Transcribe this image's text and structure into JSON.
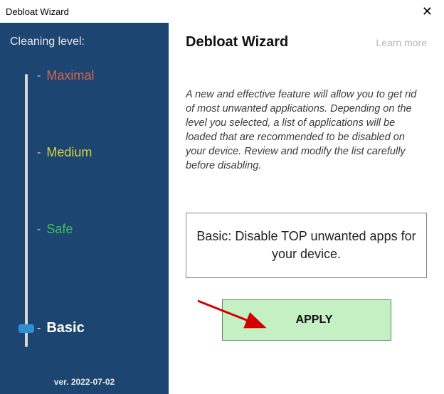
{
  "window": {
    "title": "Debloat Wizard"
  },
  "sidebar": {
    "title": "Cleaning level:",
    "levels": {
      "maximal": "Maximal",
      "medium": "Medium",
      "safe": "Safe",
      "basic": "Basic"
    },
    "version": "ver. 2022-07-02"
  },
  "main": {
    "title": "Debloat Wizard",
    "learn_more": "Learn more",
    "description": "A new and effective feature will allow you to get rid of most unwanted applications. Depending on the level you selected, a list of applications will be loaded that are recommended to be disabled on your device. Review and modify the list carefully before disabling.",
    "summary": "Basic: Disable TOP unwanted apps for your device.",
    "apply_label": "APPLY"
  },
  "colors": {
    "sidebar_bg": "#1c4572",
    "maximal": "#d9664a",
    "medium": "#d6d03a",
    "safe": "#3fbf5f",
    "apply_bg": "#c4f0c4",
    "arrow": "#d40000"
  }
}
